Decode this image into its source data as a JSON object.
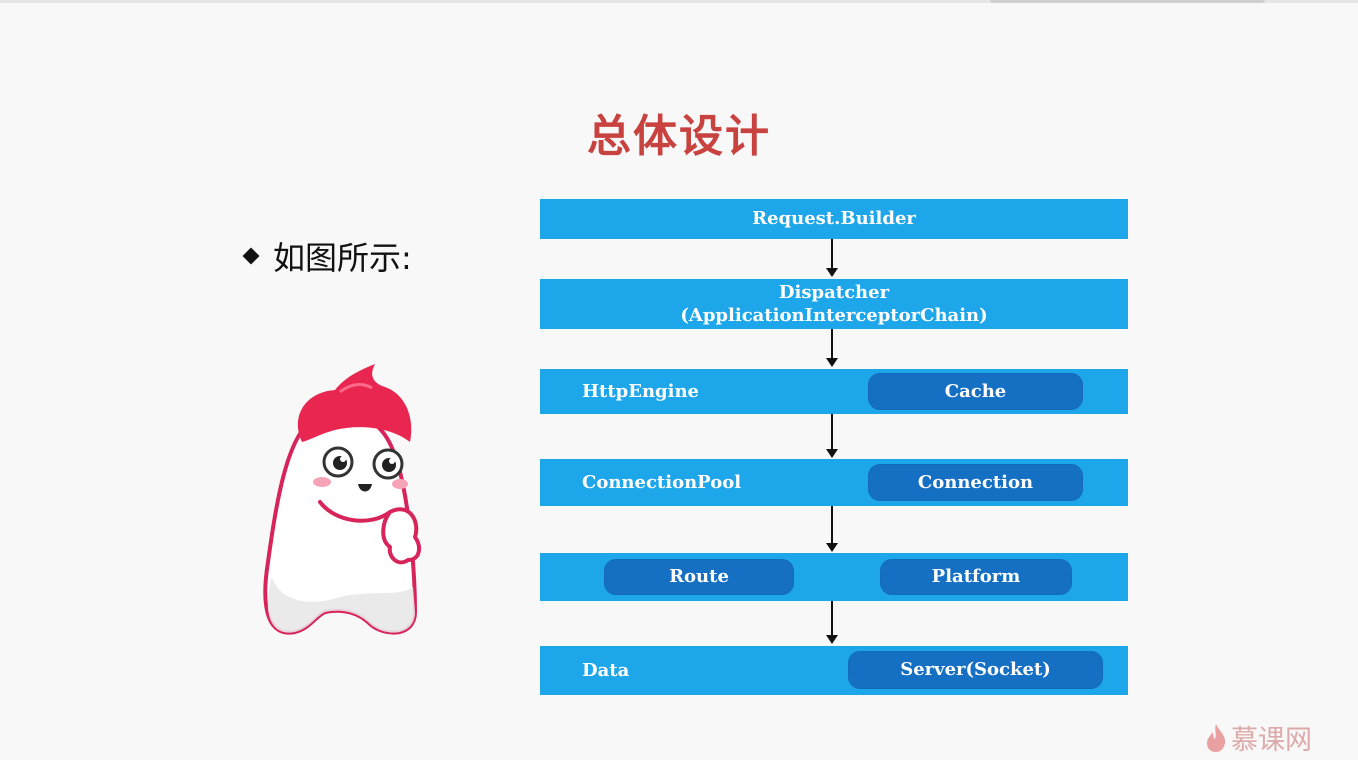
{
  "slide": {
    "title": "总体设计",
    "bullet_text": "如图所示:"
  },
  "diagram": {
    "layers": [
      {
        "label": "Request.Builder"
      },
      {
        "label_line1": "Dispatcher",
        "label_line2": "(ApplicationInterceptorChain)"
      },
      {
        "label": "HttpEngine",
        "pill": "Cache"
      },
      {
        "label": "ConnectionPool",
        "pill": "Connection"
      },
      {
        "pill_left": "Route",
        "pill_right": "Platform"
      },
      {
        "label": "Data",
        "pill": "Server(Socket)"
      }
    ],
    "colors": {
      "layer": "#1ea6ea",
      "pill": "#1570c4",
      "title": "#c8433f"
    }
  },
  "branding": {
    "logo_text": "慕课网",
    "logo_icon": "flame-icon"
  },
  "illustration": {
    "mascot_icon": "mascot-character-icon"
  }
}
